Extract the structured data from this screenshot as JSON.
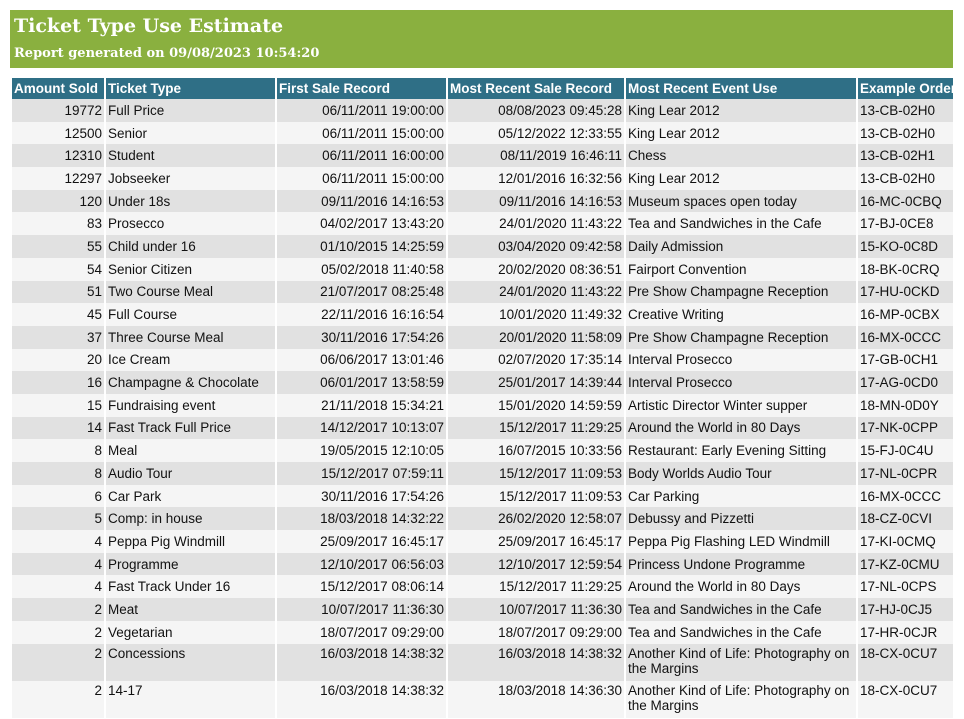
{
  "report": {
    "title": "Ticket Type Use Estimate",
    "generated": "Report generated on 09/08/2023 10:54:20"
  },
  "colors": {
    "banner": "#8ab03f",
    "header": "#2f6f86",
    "row_odd": "#e1e1e1",
    "row_even": "#f5f5f5"
  },
  "table": {
    "columns": [
      "Amount Sold",
      "Ticket Type",
      "First Sale Record",
      "Most Recent Sale Record",
      "Most Recent  Event Use",
      "Example Order"
    ],
    "rows": [
      [
        "19772",
        "Full Price",
        "06/11/2011 19:00:00",
        "08/08/2023 09:45:28",
        "King Lear 2012",
        "13-CB-02H0"
      ],
      [
        "12500",
        "Senior",
        "06/11/2011 15:00:00",
        "05/12/2022 12:33:55",
        "King Lear 2012",
        "13-CB-02H0"
      ],
      [
        "12310",
        "Student",
        "06/11/2011 16:00:00",
        "08/11/2019 16:46:11",
        "Chess",
        "13-CB-02H1"
      ],
      [
        "12297",
        "Jobseeker",
        "06/11/2011 15:00:00",
        "12/01/2016 16:32:56",
        "King Lear 2012",
        "13-CB-02H0"
      ],
      [
        "120",
        "Under 18s",
        "09/11/2016 14:16:53",
        "09/11/2016 14:16:53",
        "Museum spaces open today",
        "16-MC-0CBQ"
      ],
      [
        "83",
        "Prosecco",
        "04/02/2017 13:43:20",
        "24/01/2020 11:43:22",
        "Tea and Sandwiches in the Cafe",
        "17-BJ-0CE8"
      ],
      [
        "55",
        "Child under 16",
        "01/10/2015 14:25:59",
        "03/04/2020 09:42:58",
        "Daily Admission",
        "15-KO-0C8D"
      ],
      [
        "54",
        "Senior Citizen",
        "05/02/2018 11:40:58",
        "20/02/2020 08:36:51",
        "Fairport Convention",
        "18-BK-0CRQ"
      ],
      [
        "51",
        "Two Course Meal",
        "21/07/2017 08:25:48",
        "24/01/2020 11:43:22",
        "Pre Show Champagne Reception",
        "17-HU-0CKD"
      ],
      [
        "45",
        "Full Course",
        "22/11/2016 16:16:54",
        "10/01/2020 11:49:32",
        "Creative Writing",
        "16-MP-0CBX"
      ],
      [
        "37",
        "Three Course Meal",
        "30/11/2016 17:54:26",
        "20/01/2020 11:58:09",
        "Pre Show Champagne Reception",
        "16-MX-0CCC"
      ],
      [
        "20",
        "Ice Cream",
        "06/06/2017 13:01:46",
        "02/07/2020 17:35:14",
        "Interval Prosecco",
        "17-GB-0CH1"
      ],
      [
        "16",
        "Champagne & Chocolate",
        "06/01/2017 13:58:59",
        "25/01/2017 14:39:44",
        "Interval Prosecco",
        "17-AG-0CD0"
      ],
      [
        "15",
        "Fundraising event",
        "21/11/2018 15:34:21",
        "15/01/2020 14:59:59",
        "Artistic Director Winter supper",
        "18-MN-0D0Y"
      ],
      [
        "14",
        "Fast Track Full Price",
        "14/12/2017 10:13:07",
        "15/12/2017 11:29:25",
        "Around the World in 80 Days",
        "17-NK-0CPP"
      ],
      [
        "8",
        "Meal",
        "19/05/2015 12:10:05",
        "16/07/2015 10:33:56",
        "Restaurant: Early Evening Sitting",
        "15-FJ-0C4U"
      ],
      [
        "8",
        "Audio Tour",
        "15/12/2017 07:59:11",
        "15/12/2017 11:09:53",
        "Body Worlds Audio Tour",
        "17-NL-0CPR"
      ],
      [
        "6",
        "Car Park",
        "30/11/2016 17:54:26",
        "15/12/2017 11:09:53",
        "Car Parking",
        "16-MX-0CCC"
      ],
      [
        "5",
        "Comp: in house",
        "18/03/2018 14:32:22",
        "26/02/2020 12:58:07",
        "Debussy and Pizzetti",
        "18-CZ-0CVI"
      ],
      [
        "4",
        "Peppa Pig Windmill",
        "25/09/2017 16:45:17",
        "25/09/2017 16:45:17",
        "Peppa Pig Flashing LED Windmill",
        "17-KI-0CMQ"
      ],
      [
        "4",
        "Programme",
        "12/10/2017 06:56:03",
        "12/10/2017 12:59:54",
        "Princess Undone Programme",
        "17-KZ-0CMU"
      ],
      [
        "4",
        "Fast Track Under 16",
        "15/12/2017 08:06:14",
        "15/12/2017 11:29:25",
        "Around the World in 80 Days",
        "17-NL-0CPS"
      ],
      [
        "2",
        "Meat",
        "10/07/2017 11:36:30",
        "10/07/2017 11:36:30",
        "Tea and Sandwiches in the Cafe",
        "17-HJ-0CJ5"
      ],
      [
        "2",
        "Vegetarian",
        "18/07/2017 09:29:00",
        "18/07/2017 09:29:00",
        "Tea and Sandwiches in the Cafe",
        "17-HR-0CJR"
      ],
      [
        "2",
        "Concessions",
        "16/03/2018 14:38:32",
        "16/03/2018 14:38:32",
        "Another Kind of Life: Photography on the Margins",
        "18-CX-0CU7"
      ],
      [
        "2",
        "14-17",
        "16/03/2018 14:38:32",
        "18/03/2018 14:36:30",
        "Another Kind of Life: Photography on the Margins",
        "18-CX-0CU7"
      ]
    ]
  }
}
